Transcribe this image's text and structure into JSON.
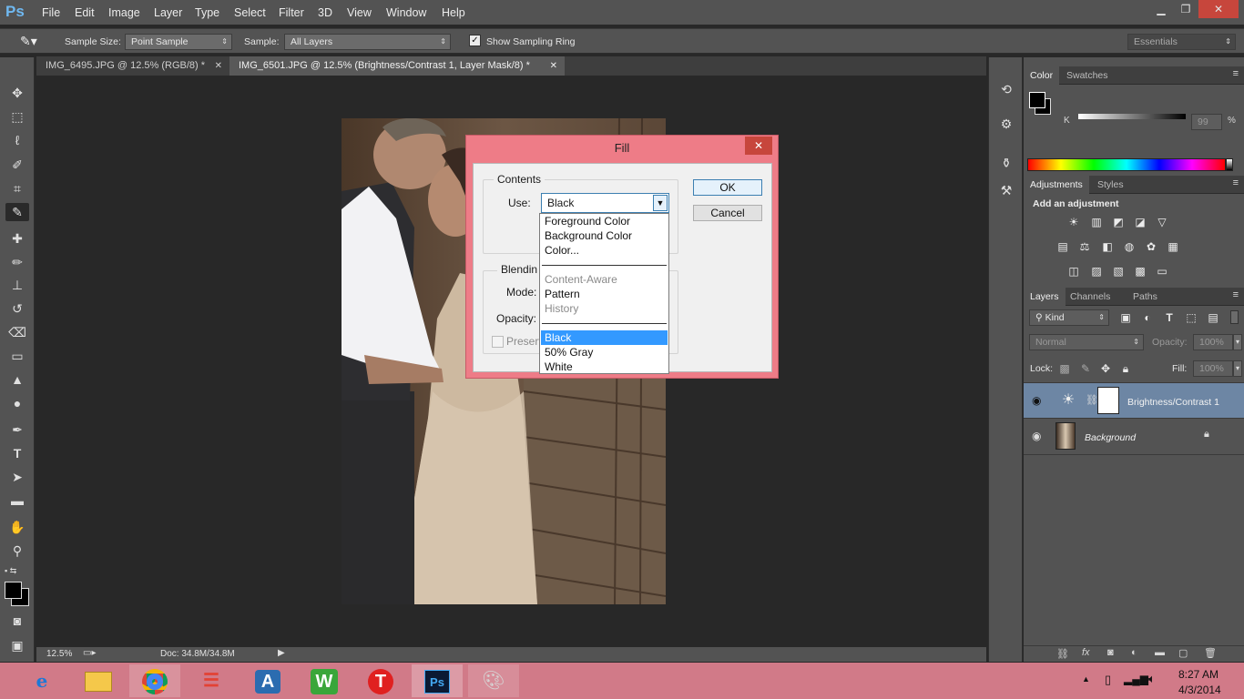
{
  "app": {
    "logo": "Ps"
  },
  "menu": [
    "File",
    "Edit",
    "Image",
    "Layer",
    "Type",
    "Select",
    "Filter",
    "3D",
    "View",
    "Window",
    "Help"
  ],
  "window_controls": {
    "minimize": "▁",
    "restore": "❐",
    "close": "✕"
  },
  "options": {
    "sample_size_label": "Sample Size:",
    "sample_size_value": "Point Sample",
    "sample_label": "Sample:",
    "sample_value": "All Layers",
    "sampling_ring_label": "Show Sampling Ring",
    "sampling_ring_checked": true,
    "workspace": "Essentials"
  },
  "tabs": [
    {
      "label": "IMG_6495.JPG @ 12.5% (RGB/8) *"
    },
    {
      "label": "IMG_6501.JPG @ 12.5% (Brightness/Contrast 1, Layer Mask/8) *"
    }
  ],
  "status": {
    "zoom": "12.5%",
    "doc": "Doc: 34.8M/34.8M"
  },
  "color_panel": {
    "tabs": [
      "Color",
      "Swatches"
    ],
    "channel": "K",
    "value": "99",
    "unit": "%"
  },
  "adjustments_panel": {
    "tabs": [
      "Adjustments",
      "Styles"
    ],
    "heading": "Add an adjustment"
  },
  "layers_panel": {
    "tabs": [
      "Layers",
      "Channels",
      "Paths"
    ],
    "filter": "Kind",
    "blend_mode": "Normal",
    "opacity_label": "Opacity:",
    "opacity_value": "100%",
    "lock_label": "Lock:",
    "fill_label": "Fill:",
    "fill_value": "100%",
    "layers": [
      {
        "name": "Brightness/Contrast 1",
        "selected": true
      },
      {
        "name": "Background",
        "locked": true
      }
    ]
  },
  "dialog": {
    "title": "Fill",
    "contents_label": "Contents",
    "use_label": "Use:",
    "use_value": "Black",
    "blending_label": "Blendin",
    "mode_label": "Mode:",
    "opacity_label": "Opacity:",
    "preserve_label": "Preserv",
    "ok": "OK",
    "cancel": "Cancel",
    "close": "✕"
  },
  "dropdown": {
    "group1": [
      "Foreground Color",
      "Background Color",
      "Color..."
    ],
    "group2": [
      {
        "label": "Content-Aware",
        "disabled": true
      },
      {
        "label": "Pattern",
        "disabled": false
      },
      {
        "label": "History",
        "disabled": true
      }
    ],
    "group3": [
      "Black",
      "50% Gray",
      "White"
    ],
    "selected": "Black"
  },
  "taskbar": {
    "time": "8:27 AM",
    "date": "4/3/2014"
  },
  "colors": {
    "accent_dialog": "#ee7c87",
    "taskbar": "#d17a88",
    "selection": "#3399ff",
    "ui_gray": "#535353"
  }
}
